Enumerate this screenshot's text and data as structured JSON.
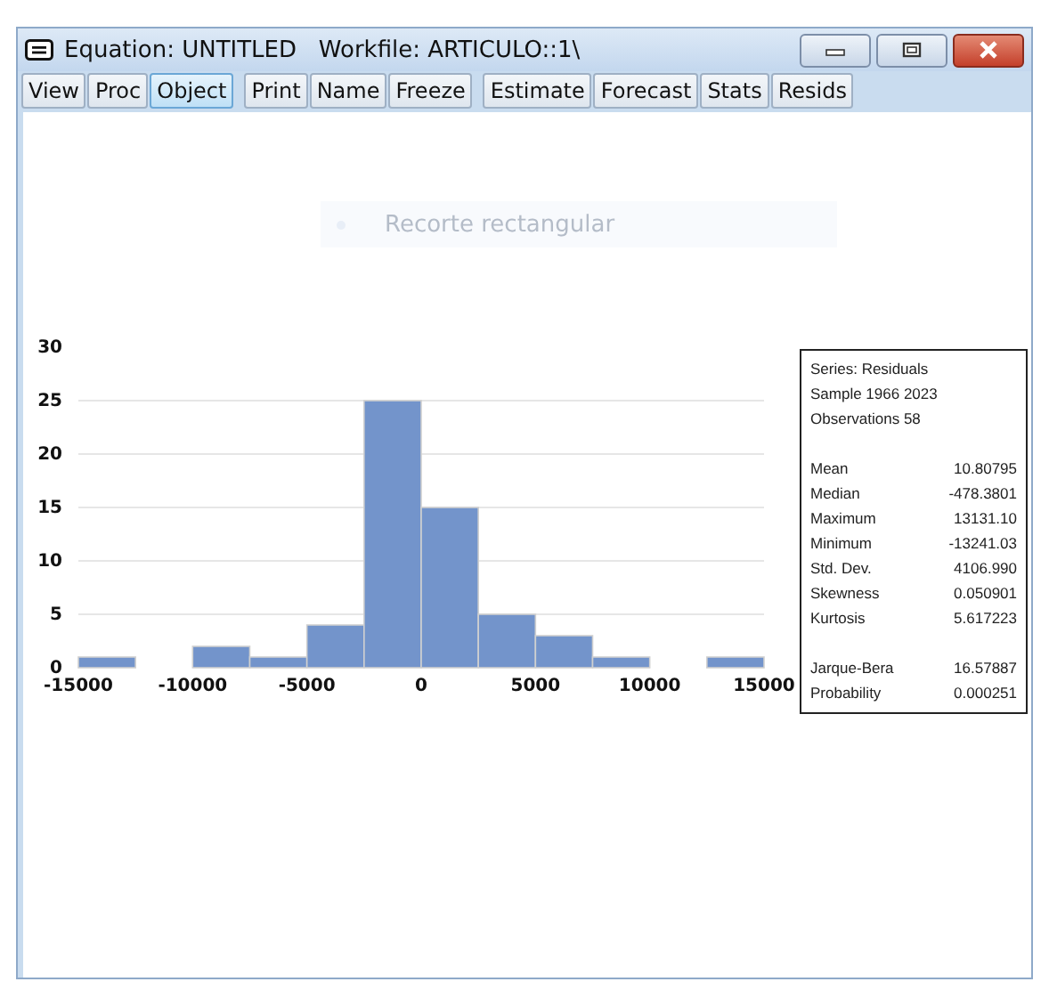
{
  "window": {
    "title": "Equation: UNTITLED   Workfile: ARTICULO::1\\"
  },
  "toolbar": [
    [
      {
        "label": "View",
        "selected": false
      },
      {
        "label": "Proc",
        "selected": false
      },
      {
        "label": "Object",
        "selected": true
      }
    ],
    [
      {
        "label": "Print",
        "selected": false
      },
      {
        "label": "Name",
        "selected": false
      },
      {
        "label": "Freeze",
        "selected": false
      }
    ],
    [
      {
        "label": "Estimate",
        "selected": false
      },
      {
        "label": "Forecast",
        "selected": false
      },
      {
        "label": "Stats",
        "selected": false
      },
      {
        "label": "Resids",
        "selected": false
      }
    ]
  ],
  "toast": {
    "label": "Recorte rectangular"
  },
  "chart": {
    "chart_data": {
      "type": "bar",
      "x": [
        -13750,
        -11250,
        -8750,
        -6250,
        -3750,
        -1250,
        1250,
        3750,
        6250,
        8750,
        11250,
        13750
      ],
      "values": [
        1,
        0,
        2,
        1,
        4,
        25,
        15,
        5,
        3,
        1,
        0,
        1
      ],
      "xlim": [
        -15000,
        15000
      ],
      "ylim": [
        0,
        30
      ],
      "xticks": [
        -15000,
        -10000,
        -5000,
        0,
        5000,
        10000,
        15000
      ],
      "yticks": [
        0,
        5,
        10,
        15,
        20,
        25,
        30
      ],
      "grid": true
    }
  },
  "stats": {
    "header": [
      "Series: Residuals",
      "Sample 1966 2023",
      "Observations 58"
    ],
    "groups": [
      [
        {
          "label": "Mean",
          "value": "10.80795"
        },
        {
          "label": "Median",
          "value": "-478.3801"
        },
        {
          "label": "Maximum",
          "value": "13131.10"
        },
        {
          "label": "Minimum",
          "value": "-13241.03"
        },
        {
          "label": "Std. Dev.",
          "value": "4106.990"
        },
        {
          "label": "Skewness",
          "value": "0.050901"
        },
        {
          "label": "Kurtosis",
          "value": "5.617223"
        }
      ],
      [
        {
          "label": "Jarque-Bera",
          "value": "16.57887"
        },
        {
          "label": "Probability",
          "value": "0.000251"
        }
      ]
    ]
  }
}
